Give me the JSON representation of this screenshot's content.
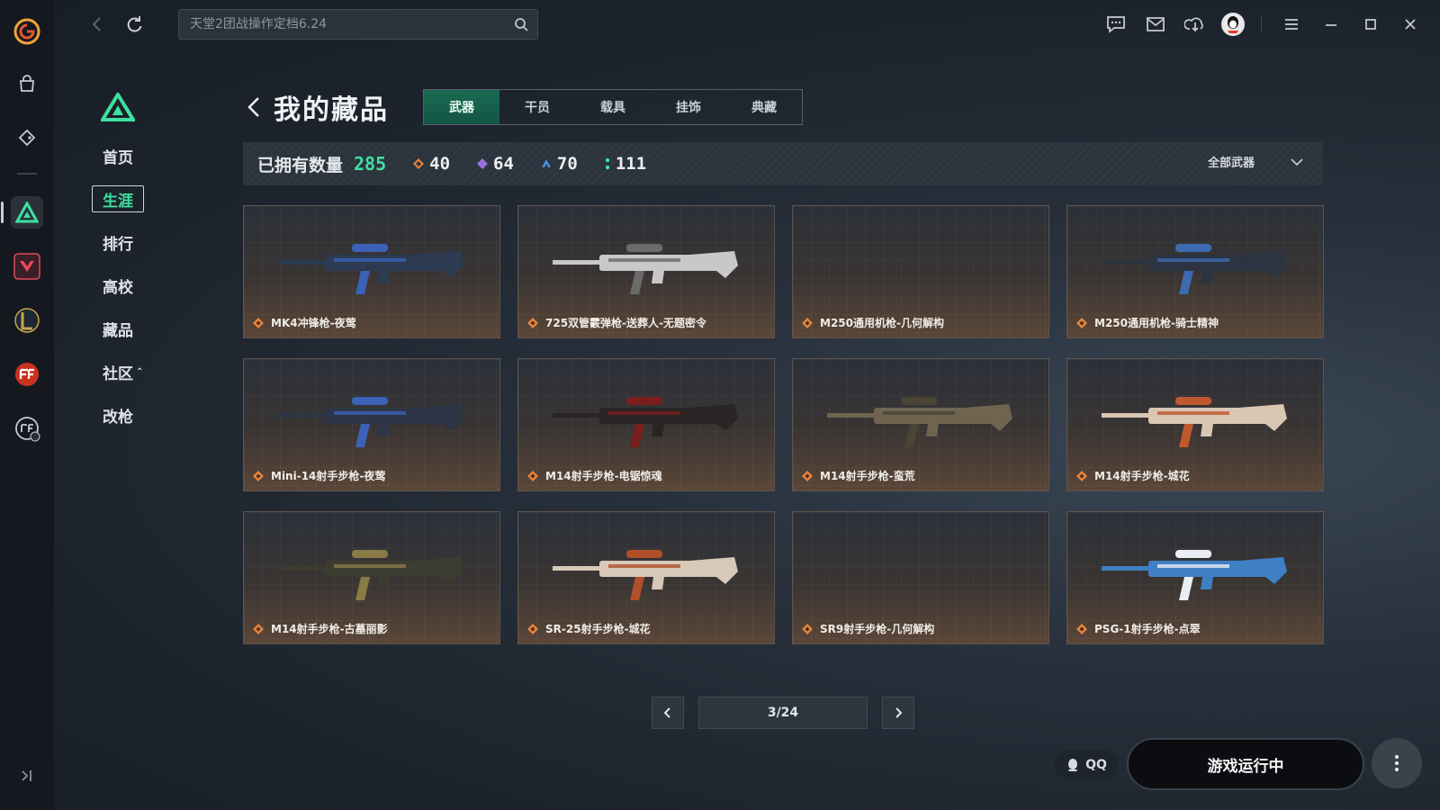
{
  "topbar": {
    "search_placeholder": "天堂2团战操作定档6.24"
  },
  "sidebar": {
    "items": [
      {
        "label": "首页",
        "active": false
      },
      {
        "label": "生涯",
        "active": true
      },
      {
        "label": "排行",
        "active": false
      },
      {
        "label": "高校",
        "active": false
      },
      {
        "label": "藏品",
        "active": false
      },
      {
        "label": "社区",
        "active": false,
        "expand_mark": "⌃"
      },
      {
        "label": "改枪",
        "active": false
      }
    ]
  },
  "header": {
    "title": "我的藏品",
    "tabs": [
      {
        "label": "武器",
        "active": true
      },
      {
        "label": "干员",
        "active": false
      },
      {
        "label": "载具",
        "active": false
      },
      {
        "label": "挂饰",
        "active": false
      },
      {
        "label": "典藏",
        "active": false
      }
    ]
  },
  "stats": {
    "owned_label": "已拥有数量",
    "owned_total": "285",
    "rarity_counts": [
      {
        "icon": "orange-diamond-icon",
        "color": "#e8833a",
        "count": "40"
      },
      {
        "icon": "purple-diamond-icon",
        "color": "#9a6ee0",
        "count": "64"
      },
      {
        "icon": "blue-triangle-icon",
        "color": "#4a8fe0",
        "count": "70"
      },
      {
        "icon": "green-dots-icon",
        "color": "#3ee0a0",
        "count": "111"
      }
    ],
    "filter_label": "全部武器"
  },
  "items": [
    {
      "name": "MK4冲锋枪-夜莺",
      "tone": "#2c3a52",
      "accent": "#3b62b8"
    },
    {
      "name": "725双管霰弹枪-送葬人-无题密令",
      "tone": "#c8c8c8",
      "accent": "#6b6b6b"
    },
    {
      "name": "M250通用机枪-几何解构",
      "tone": "",
      "accent": ""
    },
    {
      "name": "M250通用机枪-骑士精神",
      "tone": "#2b3440",
      "accent": "#3d6ab0"
    },
    {
      "name": "Mini-14射手步枪-夜莺",
      "tone": "#2c3646",
      "accent": "#3b62b8"
    },
    {
      "name": "M14射手步枪-电锯惊魂",
      "tone": "#2a2424",
      "accent": "#7a1e1e"
    },
    {
      "name": "M14射手步枪-蛮荒",
      "tone": "#6e6450",
      "accent": "#4a4336"
    },
    {
      "name": "M14射手步枪-城花",
      "tone": "#d9c7b4",
      "accent": "#c0582e"
    },
    {
      "name": "M14射手步枪-古墓丽影",
      "tone": "#3c3c30",
      "accent": "#8a7a46"
    },
    {
      "name": "SR-25射手步枪-城花",
      "tone": "#d8c8b8",
      "accent": "#b0502a"
    },
    {
      "name": "SR9射手步枪-几何解构",
      "tone": "",
      "accent": ""
    },
    {
      "name": "PSG-1射手步枪-点翠",
      "tone": "#3f7fc4",
      "accent": "#e9eef4"
    }
  ],
  "pager": {
    "label": "3/24"
  },
  "bottom": {
    "qq_label": "QQ",
    "status_button": "游戏运行中"
  },
  "colors": {
    "accent_green": "#3ee0a0",
    "rarity_orange": "#e8833a"
  }
}
